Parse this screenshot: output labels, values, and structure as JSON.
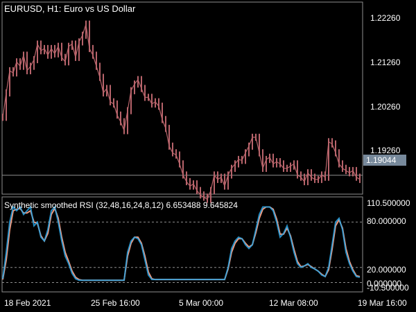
{
  "chart": {
    "symbol_title": "EURUSD, H1:  Euro vs US Dollar",
    "price_ticks": [
      "1.22260",
      "1.21260",
      "1.20260",
      "1.19260"
    ],
    "current_price": "1.19044",
    "indicator_title": "Synthetic smoothed RSI (32,48,16,24,8,12) 6.653488 9.645824",
    "indicator_ticks": [
      "110.500000",
      "80.000000",
      "20.000000",
      "0.000000",
      "-10.500000"
    ],
    "time_ticks": [
      "18 Feb 2021",
      "25 Feb 16:00",
      "5 Mar 00:00",
      "12 Mar 08:00",
      "19 Mar 16:00"
    ],
    "colors": {
      "background": "#000000",
      "candles": "#b8646b",
      "rsi_up": "#29a3e3",
      "rsi_down": "#f39a7e",
      "grid": "#8f8f8f"
    }
  },
  "chart_data": {
    "type": "line",
    "price_series": {
      "x": [
        0,
        5,
        10,
        15,
        20,
        25,
        30,
        35,
        40,
        45,
        50,
        55,
        60,
        65,
        70,
        75,
        80,
        85,
        90,
        95,
        100,
        105,
        110,
        115,
        120,
        125,
        130,
        135,
        140,
        145,
        150,
        155,
        160,
        165,
        170,
        175,
        180,
        185,
        190,
        195,
        200,
        205,
        210,
        215,
        220,
        225,
        230,
        235,
        240,
        245,
        250,
        255,
        260,
        265,
        270,
        275,
        280,
        285,
        290,
        295,
        300,
        305,
        310,
        315,
        320,
        325,
        330,
        335,
        340,
        345,
        350,
        355,
        360,
        365,
        370,
        375,
        380,
        385,
        390,
        395,
        400,
        405,
        410,
        415,
        420,
        425,
        430,
        435,
        440,
        445,
        450,
        455,
        460,
        465,
        470,
        475,
        480,
        485,
        490,
        495,
        500,
        505,
        510,
        515
      ],
      "close": [
        1.2035,
        1.209,
        1.214,
        1.2135,
        1.216,
        1.215,
        1.2175,
        1.214,
        1.215,
        1.2165,
        1.22,
        1.2185,
        1.219,
        1.2175,
        1.219,
        1.2178,
        1.2195,
        1.217,
        1.216,
        1.2195,
        1.22,
        1.217,
        1.2205,
        1.222,
        1.2245,
        1.219,
        1.2175,
        1.215,
        1.2125,
        1.209,
        1.21,
        1.207,
        1.2065,
        1.204,
        1.2025,
        1.2005,
        1.205,
        1.2095,
        1.211,
        1.212,
        1.21,
        1.208,
        1.208,
        1.2065,
        1.207,
        1.206,
        1.203,
        1.201,
        1.197,
        1.1955,
        1.195,
        1.193,
        1.1905,
        1.189,
        1.188,
        1.1885,
        1.187,
        1.186,
        1.1855,
        1.185,
        1.187,
        1.1905,
        1.1895,
        1.19,
        1.188,
        1.1905,
        1.192,
        1.193,
        1.194,
        1.1938,
        1.1955,
        1.197,
        1.199,
        1.199,
        1.1955,
        1.192,
        1.194,
        1.1945,
        1.193,
        1.1935,
        1.193,
        1.192,
        1.192,
        1.1925,
        1.193,
        1.1905,
        1.19,
        1.189,
        1.191,
        1.19,
        1.1895,
        1.1895,
        1.1905,
        1.19,
        1.198,
        1.1975,
        1.1955,
        1.193,
        1.192,
        1.1915,
        1.191,
        1.1915,
        1.19,
        1.1895
      ]
    },
    "rsi_series": [
      {
        "x": [
          0,
          5,
          10,
          15,
          20,
          25,
          30,
          35,
          40,
          45,
          50,
          55,
          60,
          65,
          70,
          75,
          80,
          85,
          90,
          95,
          100,
          105,
          110,
          115,
          120,
          125,
          130,
          135,
          140,
          145,
          150,
          155,
          160,
          165,
          170,
          175,
          180,
          185,
          190,
          195,
          200,
          205,
          210,
          215,
          220,
          225,
          230,
          235,
          240,
          245,
          250,
          255,
          260,
          265,
          270,
          275,
          280,
          285,
          290,
          295,
          300,
          305,
          310,
          315,
          320,
          325,
          330,
          335,
          340,
          345,
          350,
          355,
          360,
          365,
          370,
          375,
          380,
          385,
          390,
          395,
          400,
          405,
          410,
          415,
          420,
          425,
          430,
          435,
          440,
          445,
          450,
          455,
          460,
          465,
          470,
          475,
          480,
          485,
          490,
          495,
          500,
          505,
          510,
          515
        ],
        "values": [
          5,
          40,
          80,
          100,
          95,
          100,
          90,
          95,
          100,
          75,
          80,
          60,
          55,
          70,
          95,
          100,
          80,
          55,
          35,
          25,
          12,
          5,
          3,
          3,
          3,
          3,
          3,
          3,
          3,
          3,
          3,
          3,
          3,
          3,
          3,
          3,
          40,
          55,
          60,
          58,
          50,
          30,
          10,
          4,
          4,
          4,
          4,
          4,
          4,
          4,
          4,
          4,
          4,
          4,
          4,
          4,
          4,
          4,
          4,
          4,
          4,
          4,
          4,
          4,
          4,
          20,
          45,
          55,
          60,
          58,
          50,
          45,
          50,
          70,
          90,
          100,
          100,
          100,
          95,
          80,
          60,
          65,
          75,
          60,
          40,
          25,
          20,
          22,
          25,
          20,
          18,
          15,
          10,
          8,
          20,
          50,
          80,
          85,
          70,
          40,
          25,
          15,
          8,
          7
        ]
      },
      {
        "x": [
          0,
          5,
          10,
          15,
          20,
          25,
          30,
          35,
          40,
          45,
          50,
          55,
          60,
          65,
          70,
          75,
          80,
          85,
          90,
          95,
          100,
          105,
          110,
          115,
          120,
          125,
          130,
          135,
          140,
          145,
          150,
          155,
          160,
          165,
          170,
          175,
          180,
          185,
          190,
          195,
          200,
          205,
          210,
          215,
          220,
          225,
          230,
          235,
          240,
          245,
          250,
          255,
          260,
          265,
          270,
          275,
          280,
          285,
          290,
          295,
          300,
          305,
          310,
          315,
          320,
          325,
          330,
          335,
          340,
          345,
          350,
          355,
          360,
          365,
          370,
          375,
          380,
          385,
          390,
          395,
          400,
          405,
          410,
          415,
          420,
          425,
          430,
          435,
          440,
          445,
          450,
          455,
          460,
          465,
          470,
          475,
          480,
          485,
          490,
          495,
          500,
          505,
          510,
          515
        ],
        "values": [
          4,
          30,
          70,
          95,
          97,
          98,
          92,
          92,
          95,
          80,
          78,
          62,
          55,
          65,
          90,
          98,
          85,
          60,
          40,
          28,
          15,
          7,
          4,
          3,
          3,
          3,
          3,
          3,
          3,
          3,
          3,
          3,
          3,
          3,
          3,
          3,
          35,
          52,
          60,
          60,
          52,
          35,
          14,
          5,
          4,
          4,
          4,
          4,
          4,
          4,
          4,
          4,
          4,
          4,
          4,
          4,
          4,
          4,
          4,
          4,
          4,
          4,
          4,
          4,
          4,
          18,
          40,
          52,
          58,
          58,
          52,
          47,
          50,
          66,
          85,
          97,
          100,
          100,
          97,
          84,
          64,
          64,
          72,
          62,
          44,
          28,
          21,
          22,
          24,
          21,
          18,
          15,
          11,
          8,
          17,
          44,
          75,
          83,
          72,
          45,
          28,
          17,
          9,
          8
        ]
      }
    ],
    "ylim_price": [
      1.1865,
      1.229
    ],
    "ylim_rsi": [
      -10.5,
      110.5
    ]
  }
}
